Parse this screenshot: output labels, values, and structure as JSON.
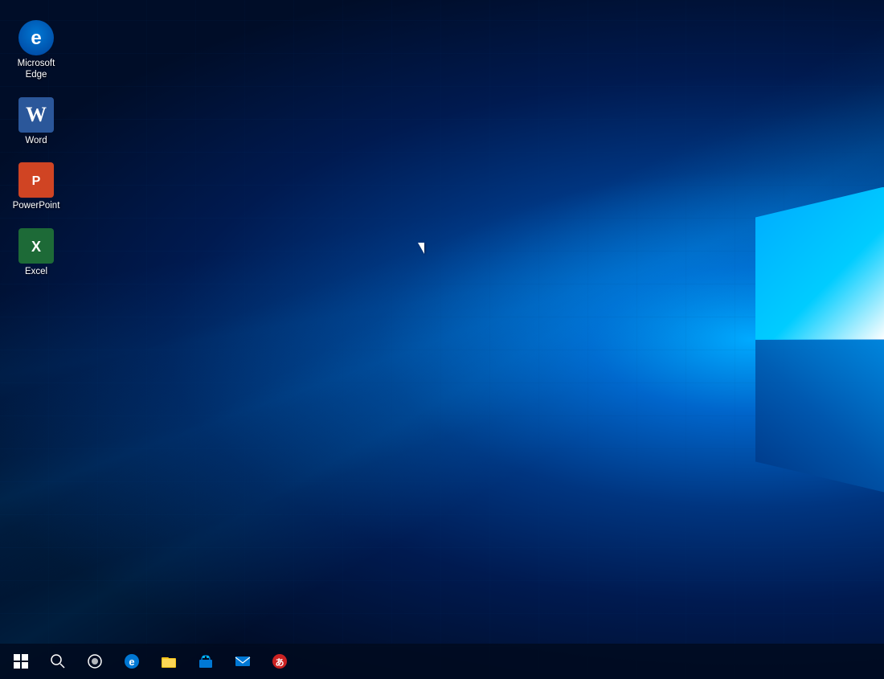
{
  "desktop": {
    "icons": [
      {
        "id": "microsoft-edge",
        "label": "Microsoft\nEdge",
        "type": "edge"
      },
      {
        "id": "word",
        "label": "Word",
        "type": "word"
      },
      {
        "id": "powerpoint",
        "label": "PowerPoint",
        "type": "powerpoint"
      },
      {
        "id": "excel",
        "label": "Excel",
        "type": "excel"
      }
    ]
  },
  "taskbar": {
    "items": [
      {
        "id": "start",
        "label": "Start",
        "type": "start"
      },
      {
        "id": "search",
        "label": "Search",
        "type": "search"
      },
      {
        "id": "cortana",
        "label": "Cortana",
        "type": "cortana"
      },
      {
        "id": "edge",
        "label": "Microsoft Edge",
        "type": "edge"
      },
      {
        "id": "explorer",
        "label": "File Explorer",
        "type": "explorer"
      },
      {
        "id": "store",
        "label": "Store",
        "type": "store"
      },
      {
        "id": "mail",
        "label": "Mail",
        "type": "mail"
      },
      {
        "id": "extra",
        "label": "App",
        "type": "extra"
      }
    ]
  }
}
